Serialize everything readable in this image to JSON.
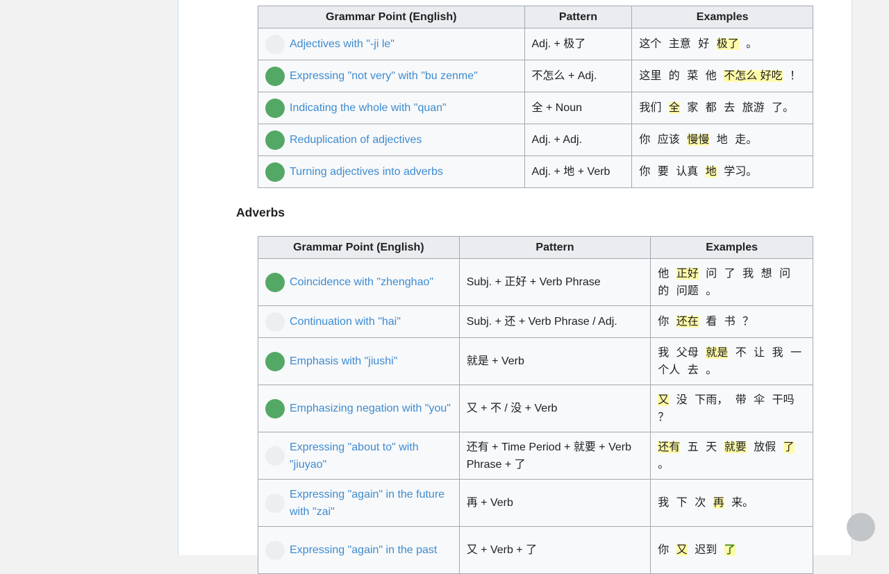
{
  "colors": {
    "link": "#3d8bd0",
    "completed_dot": "#54a866",
    "incomplete_dot": "#eceeef",
    "highlight": "#fffaa8",
    "header_bg": "#eaecf0",
    "cell_bg": "#f8f9fa"
  },
  "tables": [
    {
      "headers": [
        "Grammar Point (English)",
        "Pattern",
        "Examples"
      ],
      "rows": [
        {
          "status": "incomplete",
          "grammar_point": "Adjectives with \"-ji le\"",
          "pattern": "Adj. + 极了",
          "example": [
            {
              "t": "这个"
            },
            {
              "t": "主意"
            },
            {
              "t": "好"
            },
            {
              "t": "极了",
              "hl": true
            },
            {
              "t": "。"
            }
          ]
        },
        {
          "status": "completed",
          "grammar_point": "Expressing \"not very\" with \"bu zenme\"",
          "pattern": "不怎么 + Adj.",
          "example": [
            {
              "t": "这里"
            },
            {
              "t": "的"
            },
            {
              "t": "菜"
            },
            {
              "t": "他"
            },
            {
              "t": "不怎么 好吃",
              "hl": true
            },
            {
              "t": "！"
            }
          ]
        },
        {
          "status": "completed",
          "grammar_point": "Indicating the whole with \"quan\"",
          "pattern": "全 + Noun",
          "example": [
            {
              "t": "我们"
            },
            {
              "t": "全",
              "hl": true
            },
            {
              "t": "家"
            },
            {
              "t": "都"
            },
            {
              "t": "去"
            },
            {
              "t": "旅游"
            },
            {
              "t": "了。"
            }
          ]
        },
        {
          "status": "completed",
          "grammar_point": "Reduplication of adjectives",
          "pattern": "Adj. + Adj.",
          "example": [
            {
              "t": "你"
            },
            {
              "t": "应该"
            },
            {
              "t": "慢慢",
              "hl": true
            },
            {
              "t": "地"
            },
            {
              "t": "走。"
            }
          ]
        },
        {
          "status": "completed",
          "grammar_point": "Turning adjectives into adverbs",
          "pattern": "Adj. + 地 + Verb",
          "example": [
            {
              "t": "你"
            },
            {
              "t": "要"
            },
            {
              "t": "认真"
            },
            {
              "t": "地",
              "hl": true
            },
            {
              "t": "学习。"
            }
          ]
        }
      ]
    },
    {
      "section_title": "Adverbs",
      "headers": [
        "Grammar Point (English)",
        "Pattern",
        "Examples"
      ],
      "rows": [
        {
          "status": "completed",
          "grammar_point": "Coincidence with \"zhenghao\"",
          "pattern": "Subj. + 正好 + Verb Phrase",
          "example": [
            {
              "t": "他"
            },
            {
              "t": "正好",
              "hl": true
            },
            {
              "t": "问"
            },
            {
              "t": "了"
            },
            {
              "t": "我"
            },
            {
              "t": "想"
            },
            {
              "t": "问"
            },
            {
              "t": "的"
            },
            {
              "t": "问题"
            },
            {
              "t": "。"
            }
          ]
        },
        {
          "status": "incomplete",
          "grammar_point": "Continuation with \"hai\"",
          "pattern": "Subj. + 还 + Verb Phrase / Adj.",
          "example": [
            {
              "t": "你"
            },
            {
              "t": "还在",
              "hl": true
            },
            {
              "t": "看"
            },
            {
              "t": "书"
            },
            {
              "t": "？"
            }
          ]
        },
        {
          "status": "completed",
          "grammar_point": "Emphasis with \"jiushi\"",
          "pattern": "就是 + Verb",
          "example": [
            {
              "t": "我"
            },
            {
              "t": "父母"
            },
            {
              "t": "就是",
              "hl": true
            },
            {
              "t": "不"
            },
            {
              "t": "让"
            },
            {
              "t": "我"
            },
            {
              "t": "一个人"
            },
            {
              "t": "去"
            },
            {
              "t": "。"
            }
          ]
        },
        {
          "status": "completed",
          "grammar_point": "Emphasizing negation with \"you\"",
          "pattern": "又 + 不 / 没 + Verb",
          "example": [
            {
              "t": "又",
              "hl": true
            },
            {
              "t": "没"
            },
            {
              "t": "下雨，"
            },
            {
              "t": "带"
            },
            {
              "t": "伞"
            },
            {
              "t": "干吗"
            },
            {
              "t": "？"
            }
          ]
        },
        {
          "status": "incomplete",
          "grammar_point": "Expressing \"about to\" with \"jiuyao\"",
          "pattern": "还有 + Time Period + 就要 + Verb Phrase + 了",
          "example": [
            {
              "t": "还有",
              "hl": true
            },
            {
              "t": "五"
            },
            {
              "t": "天"
            },
            {
              "t": "就要",
              "hl": true
            },
            {
              "t": "放假"
            },
            {
              "t": "了",
              "hl": true
            },
            {
              "t": "。"
            }
          ]
        },
        {
          "status": "incomplete",
          "grammar_point": "Expressing \"again\" in the future with \"zai\"",
          "pattern": "再 + Verb",
          "example": [
            {
              "t": "我"
            },
            {
              "t": "下"
            },
            {
              "t": "次"
            },
            {
              "t": "再",
              "hl": true
            },
            {
              "t": "来。"
            }
          ]
        },
        {
          "status": "incomplete",
          "grammar_point": "Expressing \"again\" in the past",
          "pattern": "又 + Verb + 了",
          "example": [
            {
              "t": "你"
            },
            {
              "t": "又",
              "hl": true
            },
            {
              "t": "迟到"
            },
            {
              "t": "了",
              "hl": "green"
            }
          ]
        }
      ]
    }
  ]
}
